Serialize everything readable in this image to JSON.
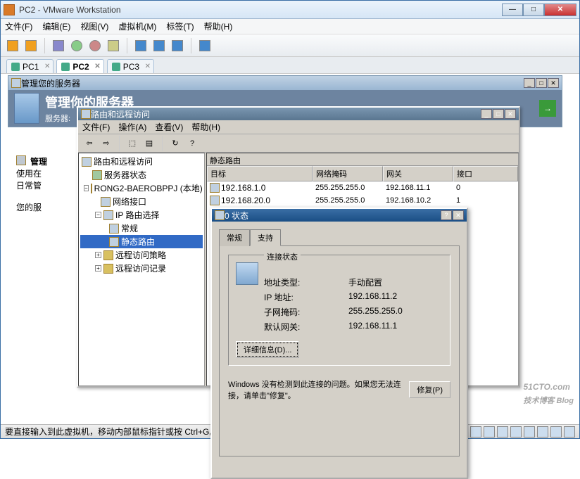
{
  "window": {
    "title": "PC2 - VMware Workstation"
  },
  "menu": {
    "file": "文件(F)",
    "edit": "编辑(E)",
    "view": "视图(V)",
    "vm": "虚拟机(M)",
    "tabs": "标签(T)",
    "help": "帮助(H)"
  },
  "vm_tabs": [
    {
      "label": "PC1",
      "active": false
    },
    {
      "label": "PC2",
      "active": true
    },
    {
      "label": "PC3",
      "active": false
    }
  ],
  "mgr_window": {
    "titlebar": "管理您的服务器",
    "heading": "管理你的服务器",
    "sub": "服务器:"
  },
  "side_text": {
    "l1": "管理",
    "l2": "使用在",
    "l3": "日常管",
    "l4": "您的服"
  },
  "rras": {
    "title": "路由和远程访问",
    "menu": {
      "file": "文件(F)",
      "action": "操作(A)",
      "view": "查看(V)",
      "help": "帮助(H)"
    },
    "tree": {
      "root": "路由和远程访问",
      "status": "服务器状态",
      "host": "RONG2-BAEROBPPJ (本地)",
      "iface": "网络接口",
      "iproute": "IP 路由选择",
      "general": "常规",
      "static": "静态路由",
      "policy": "远程访问策略",
      "log": "远程访问记录"
    },
    "list": {
      "header": "静态路由",
      "cols": {
        "dest": "目标",
        "mask": "网络掩码",
        "gw": "网关",
        "iface": "接口"
      },
      "rows": [
        {
          "dest": "192.168.1.0",
          "mask": "255.255.255.0",
          "gw": "192.168.11.1",
          "iface": "0"
        },
        {
          "dest": "192.168.20.0",
          "mask": "255.255.255.0",
          "gw": "192.168.10.2",
          "iface": "1"
        }
      ]
    }
  },
  "status": {
    "title": "0 状态",
    "tabs": {
      "general": "常规",
      "support": "支持"
    },
    "group_title": "连接状态",
    "rows": {
      "type_lbl": "地址类型:",
      "type_val": "手动配置",
      "ip_lbl": "IP 地址:",
      "ip_val": "192.168.11.2",
      "mask_lbl": "子网掩码:",
      "mask_val": "255.255.255.0",
      "gw_lbl": "默认网关:",
      "gw_val": "192.168.11.1"
    },
    "details_btn": "详细信息(D)...",
    "note": "Windows 没有检测到此连接的问题。如果您无法连接，请单击\"修复\"。",
    "repair_btn": "修复(P)"
  },
  "statusbar": {
    "msg": "要直接输入到此虚拟机，移动内部鼠标指针或按 Ctrl+G。"
  },
  "watermark": {
    "main": "51CTO.com",
    "sub": "技术博客   Blog"
  }
}
